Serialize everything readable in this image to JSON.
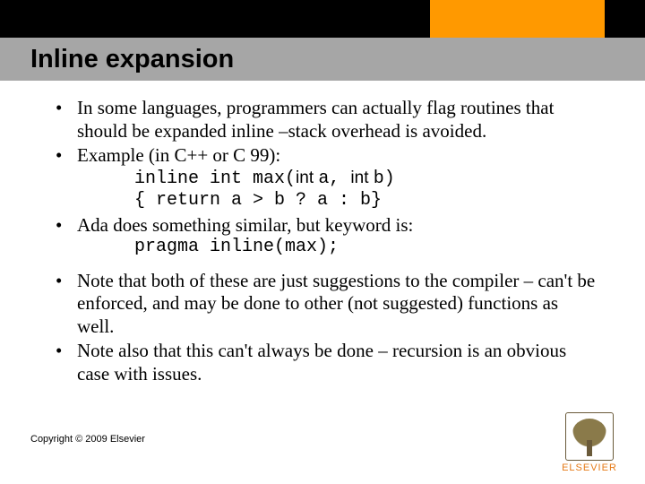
{
  "title": "Inline expansion",
  "bullets": {
    "b1": "In some languages, programmers can actually flag routines that should be expanded inline –stack overhead is avoided.",
    "b2_lead": "Example (in C++ or C 99):",
    "b2_code_l1_a": "inline int max(",
    "b2_code_l1_b": "int ",
    "b2_code_l1_c": "a, ",
    "b2_code_l1_d": "int ",
    "b2_code_l1_e": "b)",
    "b2_code_l2": "{ return a > b ? a : b}",
    "b3_lead": "Ada does something similar, but keyword is:",
    "b3_code": "pragma inline(max);",
    "b4": "Note that both of these are just suggestions to the compiler – can't be enforced, and may be done to other (not suggested) functions as well.",
    "b5": "Note also that this can't always be done – recursion is an obvious case with issues."
  },
  "copyright": "Copyright © 2009 Elsevier",
  "logo_text": "ELSEVIER"
}
